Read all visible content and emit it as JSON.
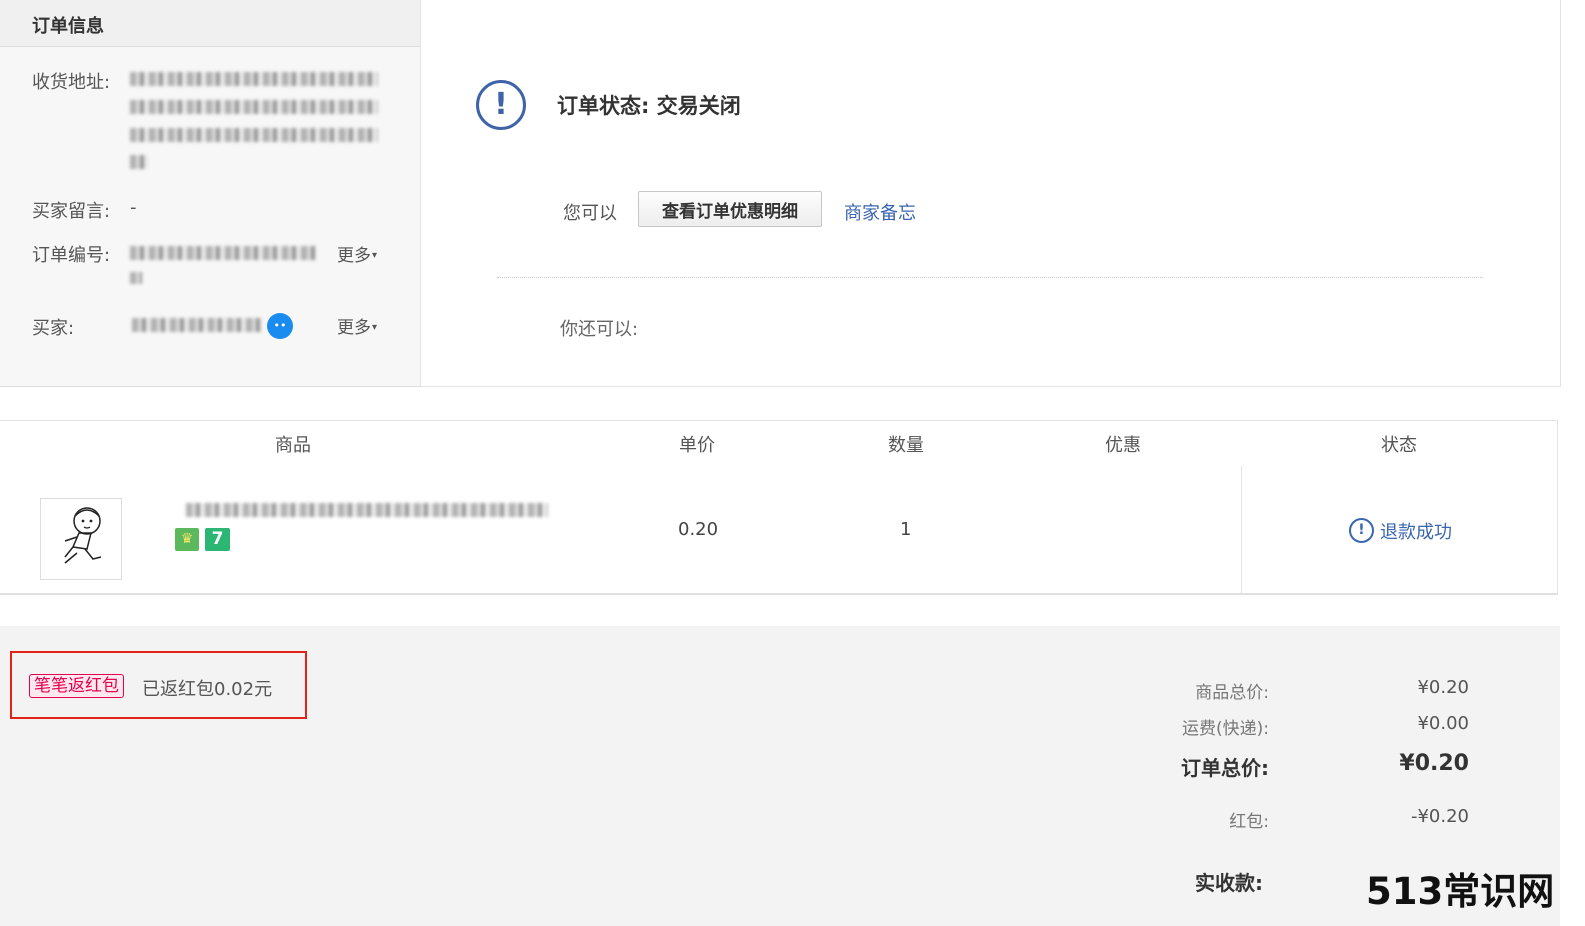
{
  "order_info": {
    "title": "订单信息",
    "address_label": "收货地址:",
    "buyer_message_label": "买家留言:",
    "buyer_message_value": "-",
    "order_no_label": "订单编号:",
    "buyer_label": "买家:",
    "more_label": "更多",
    "more_caret": "▾"
  },
  "status": {
    "title": "订单状态: 交易关闭",
    "you_can_label": "您可以",
    "detail_button": "查看订单优惠明细",
    "memo_link": "商家备忘",
    "also_can_label": "你还可以:"
  },
  "table": {
    "headers": [
      "商品",
      "单价",
      "数量",
      "优惠",
      "状态"
    ],
    "rows": [
      {
        "unit_price": "0.20",
        "quantity": "1",
        "discount": "",
        "status": "退款成功",
        "badge_2": "7"
      }
    ]
  },
  "summary": {
    "hongbao_tag": "笔笔返红包",
    "hongbao_text": "已返红包0.02元",
    "goods_total_label": "商品总价:",
    "goods_total_value": "¥0.20",
    "shipping_label": "运费(快递):",
    "shipping_value": "¥0.00",
    "order_total_label": "订单总价:",
    "order_total_value": "¥0.20",
    "hongbao_label": "红包:",
    "hongbao_value": "-¥0.20",
    "received_label": "实收款:"
  },
  "watermark": "513常识网",
  "colors": {
    "link": "#3a65b1",
    "alert_blue": "#3f63a8",
    "highlight_red": "#e2231a",
    "hongbao_pink": "#e5004f"
  }
}
